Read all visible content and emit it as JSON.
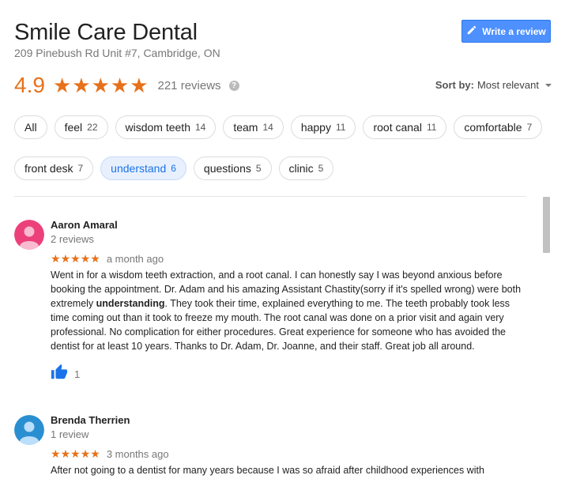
{
  "business": {
    "name": "Smile Care Dental",
    "address": "209 Pinebush Rd Unit #7, Cambridge, ON"
  },
  "write_review_label": "Write a review",
  "rating": {
    "value": "4.9",
    "stars": 5,
    "reviews_label": "221 reviews",
    "help_icon": "?"
  },
  "sort": {
    "label": "Sort by:",
    "value": "Most relevant"
  },
  "filters": [
    {
      "label": "All",
      "count": ""
    },
    {
      "label": "feel",
      "count": "22"
    },
    {
      "label": "wisdom teeth",
      "count": "14"
    },
    {
      "label": "team",
      "count": "14"
    },
    {
      "label": "happy",
      "count": "11"
    },
    {
      "label": "root canal",
      "count": "11"
    },
    {
      "label": "comfortable",
      "count": "7"
    },
    {
      "label": "front desk",
      "count": "7"
    },
    {
      "label": "understand",
      "count": "6",
      "selected": true
    },
    {
      "label": "questions",
      "count": "5"
    },
    {
      "label": "clinic",
      "count": "5"
    }
  ],
  "reviews": [
    {
      "author": "Aaron Amaral",
      "author_reviews": "2 reviews",
      "avatar_color": "#ec407a",
      "stars": 5,
      "time": "a month ago",
      "text_before": "Went in for a wisdom teeth extraction, and a root canal. I can honestly say I was beyond anxious before booking the appointment.  Dr. Adam and his amazing Assistant Chastity(sorry if it's spelled wrong) were both extremely ",
      "text_highlight": "understanding",
      "text_after": ". They took their time, explained everything to me. The teeth probably took less time coming out than it took to freeze my mouth.  The root canal was done on a prior visit and again very professional. No complication for either procedures. Great experience for someone who has avoided the dentist for at least 10 years. Thanks to Dr. Adam, Dr. Joanne, and their staff. Great job all around.",
      "likes": "1"
    },
    {
      "author": "Brenda Therrien",
      "author_reviews": "1 review",
      "avatar_color": "#2a8fd0",
      "stars": 5,
      "time": "3 months ago",
      "text_before": "After not going to a dentist for many years because I was so afraid after childhood experiences with"
    }
  ],
  "colors": {
    "accent_orange": "#e7711b",
    "button_blue": "#4d90fe",
    "selected_chip_bg": "#e8f0fe",
    "like_blue": "#1a73e8"
  }
}
